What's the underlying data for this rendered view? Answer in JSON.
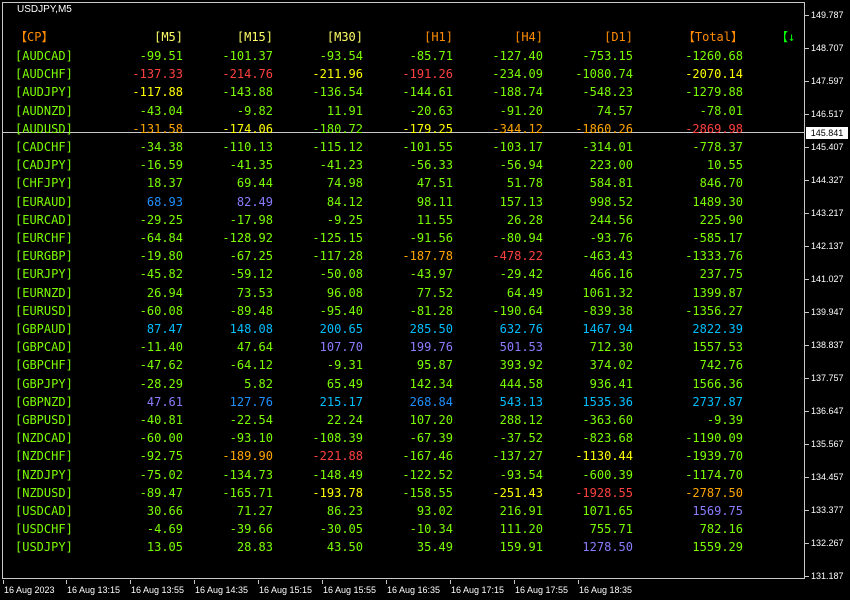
{
  "chart": {
    "symbol": "USDJPY,M5",
    "current_price": "145.841",
    "price_labels": [
      "149.787",
      "148.707",
      "147.597",
      "146.517",
      "145.407",
      "144.327",
      "143.217",
      "142.137",
      "141.027",
      "139.947",
      "138.837",
      "137.757",
      "136.647",
      "135.567",
      "134.457",
      "133.377",
      "132.267",
      "131.187"
    ],
    "time_labels": [
      "16 Aug 2023",
      "16 Aug 13:15",
      "16 Aug 13:55",
      "16 Aug 14:35",
      "16 Aug 15:15",
      "16 Aug 15:55",
      "16 Aug 16:35",
      "16 Aug 17:15",
      "16 Aug 17:55",
      "16 Aug 18:35"
    ]
  },
  "table": {
    "headers": [
      "【CP】",
      "[M5]",
      "[M15]",
      "[M30]",
      "[H1]",
      "[H4]",
      "[D1]",
      "【Total】"
    ],
    "header_colors": [
      "#ff8c00",
      "#ffff66",
      "#ffff66",
      "#ffff66",
      "#ff8c00",
      "#ff8c00",
      "#ff8c00",
      "#ff8c00"
    ],
    "sort_arrow": "【↓",
    "sort_arrow_color": "#00ff00",
    "rows": [
      {
        "symbol": "[AUDCAD]",
        "values": [
          "-99.51",
          "-101.37",
          "-93.54",
          "-85.71",
          "-127.40",
          "-753.15",
          "-1260.68"
        ],
        "colors": [
          "#7cfc00",
          "#7cfc00",
          "#7cfc00",
          "#7cfc00",
          "#7cfc00",
          "#7cfc00",
          "#7cfc00"
        ]
      },
      {
        "symbol": "[AUDCHF]",
        "values": [
          "-137.33",
          "-214.76",
          "-211.96",
          "-191.26",
          "-234.09",
          "-1080.74",
          "-2070.14"
        ],
        "colors": [
          "#ff4040",
          "#ff4040",
          "#ffff00",
          "#ff4040",
          "#7cfc00",
          "#7cfc00",
          "#ffff00"
        ]
      },
      {
        "symbol": "[AUDJPY]",
        "values": [
          "-117.88",
          "-143.88",
          "-136.54",
          "-144.61",
          "-188.74",
          "-548.23",
          "-1279.88"
        ],
        "colors": [
          "#ffff00",
          "#7cfc00",
          "#7cfc00",
          "#7cfc00",
          "#7cfc00",
          "#7cfc00",
          "#7cfc00"
        ]
      },
      {
        "symbol": "[AUDNZD]",
        "values": [
          "-43.04",
          "-9.82",
          "11.91",
          "-20.63",
          "-91.20",
          "74.57",
          "-78.01"
        ],
        "colors": [
          "#7cfc00",
          "#7cfc00",
          "#7cfc00",
          "#7cfc00",
          "#7cfc00",
          "#7cfc00",
          "#7cfc00"
        ]
      },
      {
        "symbol": "[AUDUSD]",
        "values": [
          "-131.58",
          "-174.06",
          "-180.72",
          "-179.25",
          "-344.12",
          "-1860.26",
          "-2869.98"
        ],
        "colors": [
          "#ffa500",
          "#ffff00",
          "#7cfc00",
          "#ffff00",
          "#ffa500",
          "#ffa500",
          "#ff4040"
        ]
      },
      {
        "symbol": "[CADCHF]",
        "values": [
          "-34.38",
          "-110.13",
          "-115.12",
          "-101.55",
          "-103.17",
          "-314.01",
          "-778.37"
        ],
        "colors": [
          "#7cfc00",
          "#7cfc00",
          "#7cfc00",
          "#7cfc00",
          "#7cfc00",
          "#7cfc00",
          "#7cfc00"
        ]
      },
      {
        "symbol": "[CADJPY]",
        "values": [
          "-16.59",
          "-41.35",
          "-41.23",
          "-56.33",
          "-56.94",
          "223.00",
          "10.55"
        ],
        "colors": [
          "#7cfc00",
          "#7cfc00",
          "#7cfc00",
          "#7cfc00",
          "#7cfc00",
          "#7cfc00",
          "#7cfc00"
        ]
      },
      {
        "symbol": "[CHFJPY]",
        "values": [
          "18.37",
          "69.44",
          "74.98",
          "47.51",
          "51.78",
          "584.81",
          "846.70"
        ],
        "colors": [
          "#7cfc00",
          "#7cfc00",
          "#7cfc00",
          "#7cfc00",
          "#7cfc00",
          "#7cfc00",
          "#7cfc00"
        ]
      },
      {
        "symbol": "[EURAUD]",
        "values": [
          "68.93",
          "82.49",
          "84.12",
          "98.11",
          "157.13",
          "998.52",
          "1489.30"
        ],
        "colors": [
          "#1e90ff",
          "#8a7cff",
          "#7cfc00",
          "#7cfc00",
          "#7cfc00",
          "#7cfc00",
          "#7cfc00"
        ]
      },
      {
        "symbol": "[EURCAD]",
        "values": [
          "-29.25",
          "-17.98",
          "-9.25",
          "11.55",
          "26.28",
          "244.56",
          "225.90"
        ],
        "colors": [
          "#7cfc00",
          "#7cfc00",
          "#7cfc00",
          "#7cfc00",
          "#7cfc00",
          "#7cfc00",
          "#7cfc00"
        ]
      },
      {
        "symbol": "[EURCHF]",
        "values": [
          "-64.84",
          "-128.92",
          "-125.15",
          "-91.56",
          "-80.94",
          "-93.76",
          "-585.17"
        ],
        "colors": [
          "#7cfc00",
          "#7cfc00",
          "#7cfc00",
          "#7cfc00",
          "#7cfc00",
          "#7cfc00",
          "#7cfc00"
        ]
      },
      {
        "symbol": "[EURGBP]",
        "values": [
          "-19.80",
          "-67.25",
          "-117.28",
          "-187.78",
          "-478.22",
          "-463.43",
          "-1333.76"
        ],
        "colors": [
          "#7cfc00",
          "#7cfc00",
          "#7cfc00",
          "#ffa500",
          "#ff4040",
          "#7cfc00",
          "#7cfc00"
        ]
      },
      {
        "symbol": "[EURJPY]",
        "values": [
          "-45.82",
          "-59.12",
          "-50.08",
          "-43.97",
          "-29.42",
          "466.16",
          "237.75"
        ],
        "colors": [
          "#7cfc00",
          "#7cfc00",
          "#7cfc00",
          "#7cfc00",
          "#7cfc00",
          "#7cfc00",
          "#7cfc00"
        ]
      },
      {
        "symbol": "[EURNZD]",
        "values": [
          "26.94",
          "73.53",
          "96.08",
          "77.52",
          "64.49",
          "1061.32",
          "1399.87"
        ],
        "colors": [
          "#7cfc00",
          "#7cfc00",
          "#7cfc00",
          "#7cfc00",
          "#7cfc00",
          "#7cfc00",
          "#7cfc00"
        ]
      },
      {
        "symbol": "[EURUSD]",
        "values": [
          "-60.08",
          "-89.48",
          "-95.40",
          "-81.28",
          "-190.64",
          "-839.38",
          "-1356.27"
        ],
        "colors": [
          "#7cfc00",
          "#7cfc00",
          "#7cfc00",
          "#7cfc00",
          "#7cfc00",
          "#7cfc00",
          "#7cfc00"
        ]
      },
      {
        "symbol": "[GBPAUD]",
        "values": [
          "87.47",
          "148.08",
          "200.65",
          "285.50",
          "632.76",
          "1467.94",
          "2822.39"
        ],
        "colors": [
          "#00bfff",
          "#00bfff",
          "#00bfff",
          "#00bfff",
          "#00bfff",
          "#00bfff",
          "#00bfff"
        ]
      },
      {
        "symbol": "[GBPCAD]",
        "values": [
          "-11.40",
          "47.64",
          "107.70",
          "199.76",
          "501.53",
          "712.30",
          "1557.53"
        ],
        "colors": [
          "#7cfc00",
          "#7cfc00",
          "#8a7cff",
          "#8a7cff",
          "#8a7cff",
          "#7cfc00",
          "#7cfc00"
        ]
      },
      {
        "symbol": "[GBPCHF]",
        "values": [
          "-47.62",
          "-64.12",
          "-9.31",
          "95.87",
          "393.92",
          "374.02",
          "742.76"
        ],
        "colors": [
          "#7cfc00",
          "#7cfc00",
          "#7cfc00",
          "#7cfc00",
          "#7cfc00",
          "#7cfc00",
          "#7cfc00"
        ]
      },
      {
        "symbol": "[GBPJPY]",
        "values": [
          "-28.29",
          "5.82",
          "65.49",
          "142.34",
          "444.58",
          "936.41",
          "1566.36"
        ],
        "colors": [
          "#7cfc00",
          "#7cfc00",
          "#7cfc00",
          "#7cfc00",
          "#7cfc00",
          "#7cfc00",
          "#7cfc00"
        ]
      },
      {
        "symbol": "[GBPNZD]",
        "values": [
          "47.61",
          "127.76",
          "215.17",
          "268.84",
          "543.13",
          "1535.36",
          "2737.87"
        ],
        "colors": [
          "#8a7cff",
          "#1e90ff",
          "#00bfff",
          "#1e90ff",
          "#00bfff",
          "#00bfff",
          "#00bfff"
        ]
      },
      {
        "symbol": "[GBPUSD]",
        "values": [
          "-40.81",
          "-22.54",
          "22.24",
          "107.20",
          "288.12",
          "-363.60",
          "-9.39"
        ],
        "colors": [
          "#7cfc00",
          "#7cfc00",
          "#7cfc00",
          "#7cfc00",
          "#7cfc00",
          "#7cfc00",
          "#7cfc00"
        ]
      },
      {
        "symbol": "[NZDCAD]",
        "values": [
          "-60.00",
          "-93.10",
          "-108.39",
          "-67.39",
          "-37.52",
          "-823.68",
          "-1190.09"
        ],
        "colors": [
          "#7cfc00",
          "#7cfc00",
          "#7cfc00",
          "#7cfc00",
          "#7cfc00",
          "#7cfc00",
          "#7cfc00"
        ]
      },
      {
        "symbol": "[NZDCHF]",
        "values": [
          "-92.75",
          "-189.90",
          "-221.88",
          "-167.46",
          "-137.27",
          "-1130.44",
          "-1939.70"
        ],
        "colors": [
          "#7cfc00",
          "#ffa500",
          "#ff4040",
          "#7cfc00",
          "#7cfc00",
          "#ffff00",
          "#7cfc00"
        ]
      },
      {
        "symbol": "[NZDJPY]",
        "values": [
          "-75.02",
          "-134.73",
          "-148.49",
          "-122.52",
          "-93.54",
          "-600.39",
          "-1174.70"
        ],
        "colors": [
          "#7cfc00",
          "#7cfc00",
          "#7cfc00",
          "#7cfc00",
          "#7cfc00",
          "#7cfc00",
          "#7cfc00"
        ]
      },
      {
        "symbol": "[NZDUSD]",
        "values": [
          "-89.47",
          "-165.71",
          "-193.78",
          "-158.55",
          "-251.43",
          "-1928.55",
          "-2787.50"
        ],
        "colors": [
          "#7cfc00",
          "#7cfc00",
          "#ffff00",
          "#7cfc00",
          "#ffff00",
          "#ff4040",
          "#ffa500"
        ]
      },
      {
        "symbol": "[USDCAD]",
        "values": [
          "30.66",
          "71.27",
          "86.23",
          "93.02",
          "216.91",
          "1071.65",
          "1569.75"
        ],
        "colors": [
          "#7cfc00",
          "#7cfc00",
          "#7cfc00",
          "#7cfc00",
          "#7cfc00",
          "#7cfc00",
          "#8a7cff"
        ]
      },
      {
        "symbol": "[USDCHF]",
        "values": [
          "-4.69",
          "-39.66",
          "-30.05",
          "-10.34",
          "111.20",
          "755.71",
          "782.16"
        ],
        "colors": [
          "#7cfc00",
          "#7cfc00",
          "#7cfc00",
          "#7cfc00",
          "#7cfc00",
          "#7cfc00",
          "#7cfc00"
        ]
      },
      {
        "symbol": "[USDJPY]",
        "values": [
          "13.05",
          "28.83",
          "43.50",
          "35.49",
          "159.91",
          "1278.50",
          "1559.29"
        ],
        "colors": [
          "#7cfc00",
          "#7cfc00",
          "#7cfc00",
          "#7cfc00",
          "#7cfc00",
          "#8a7cff",
          "#7cfc00"
        ]
      }
    ]
  }
}
